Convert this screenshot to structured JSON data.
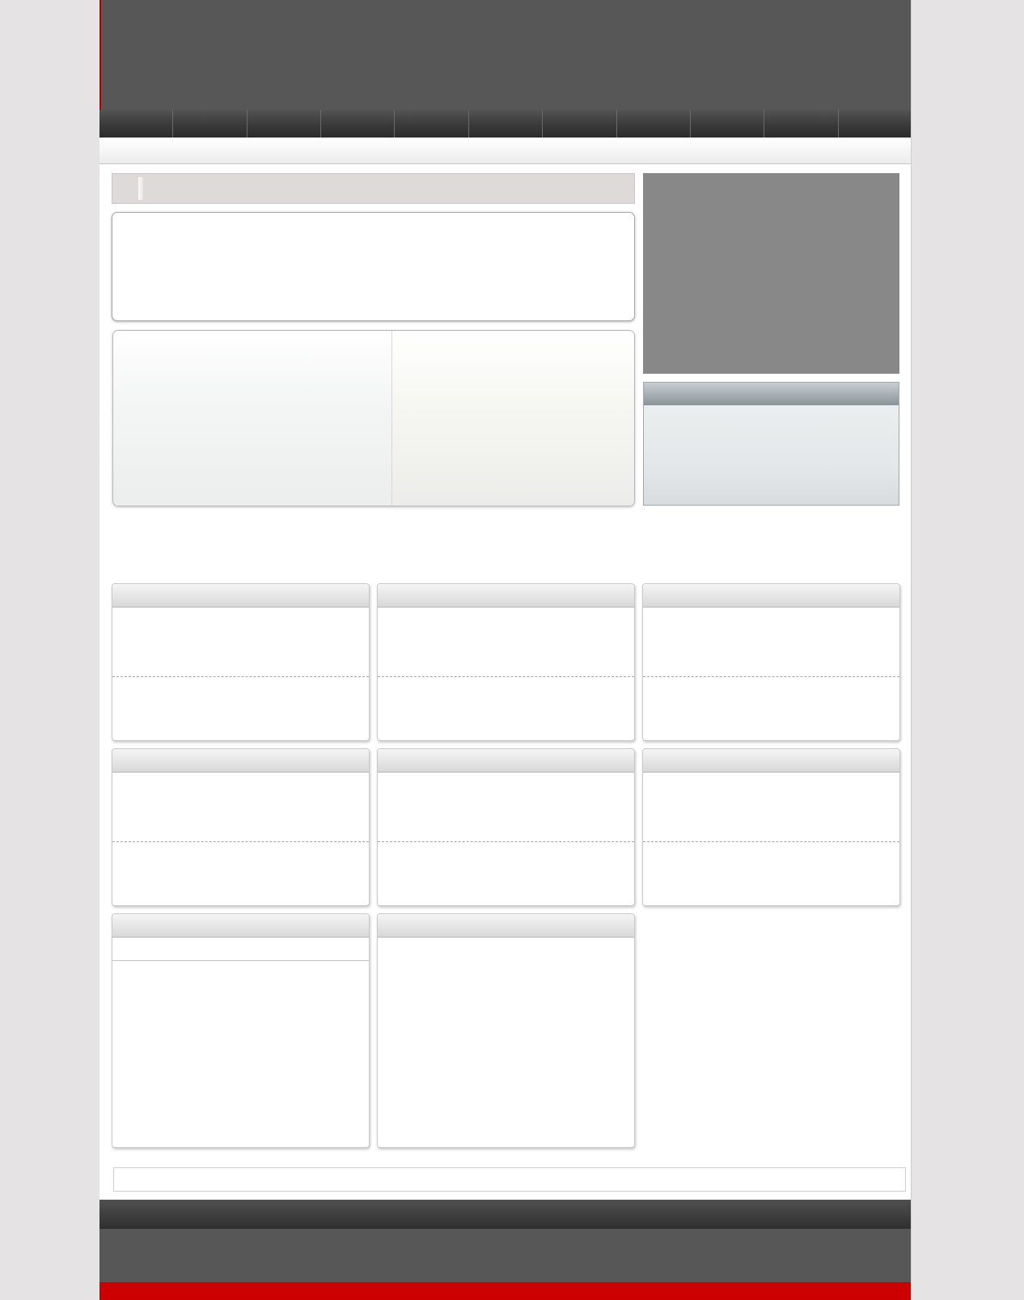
{
  "nav": {
    "items": [
      {
        "label": ""
      },
      {
        "label": ""
      },
      {
        "label": ""
      },
      {
        "label": ""
      },
      {
        "label": ""
      },
      {
        "label": ""
      },
      {
        "label": ""
      },
      {
        "label": ""
      },
      {
        "label": ""
      },
      {
        "label": ""
      },
      {
        "label": ""
      }
    ]
  },
  "colors": {
    "header": "#575757",
    "nav": "#3a3a3a",
    "accent_red": "#cc0000",
    "media_box": "#888888",
    "page_bg": "#e5e3e3"
  },
  "cards": [
    {
      "title": ""
    },
    {
      "title": ""
    },
    {
      "title": ""
    },
    {
      "title": ""
    },
    {
      "title": ""
    },
    {
      "title": ""
    },
    {
      "title": ""
    },
    {
      "title": ""
    }
  ]
}
